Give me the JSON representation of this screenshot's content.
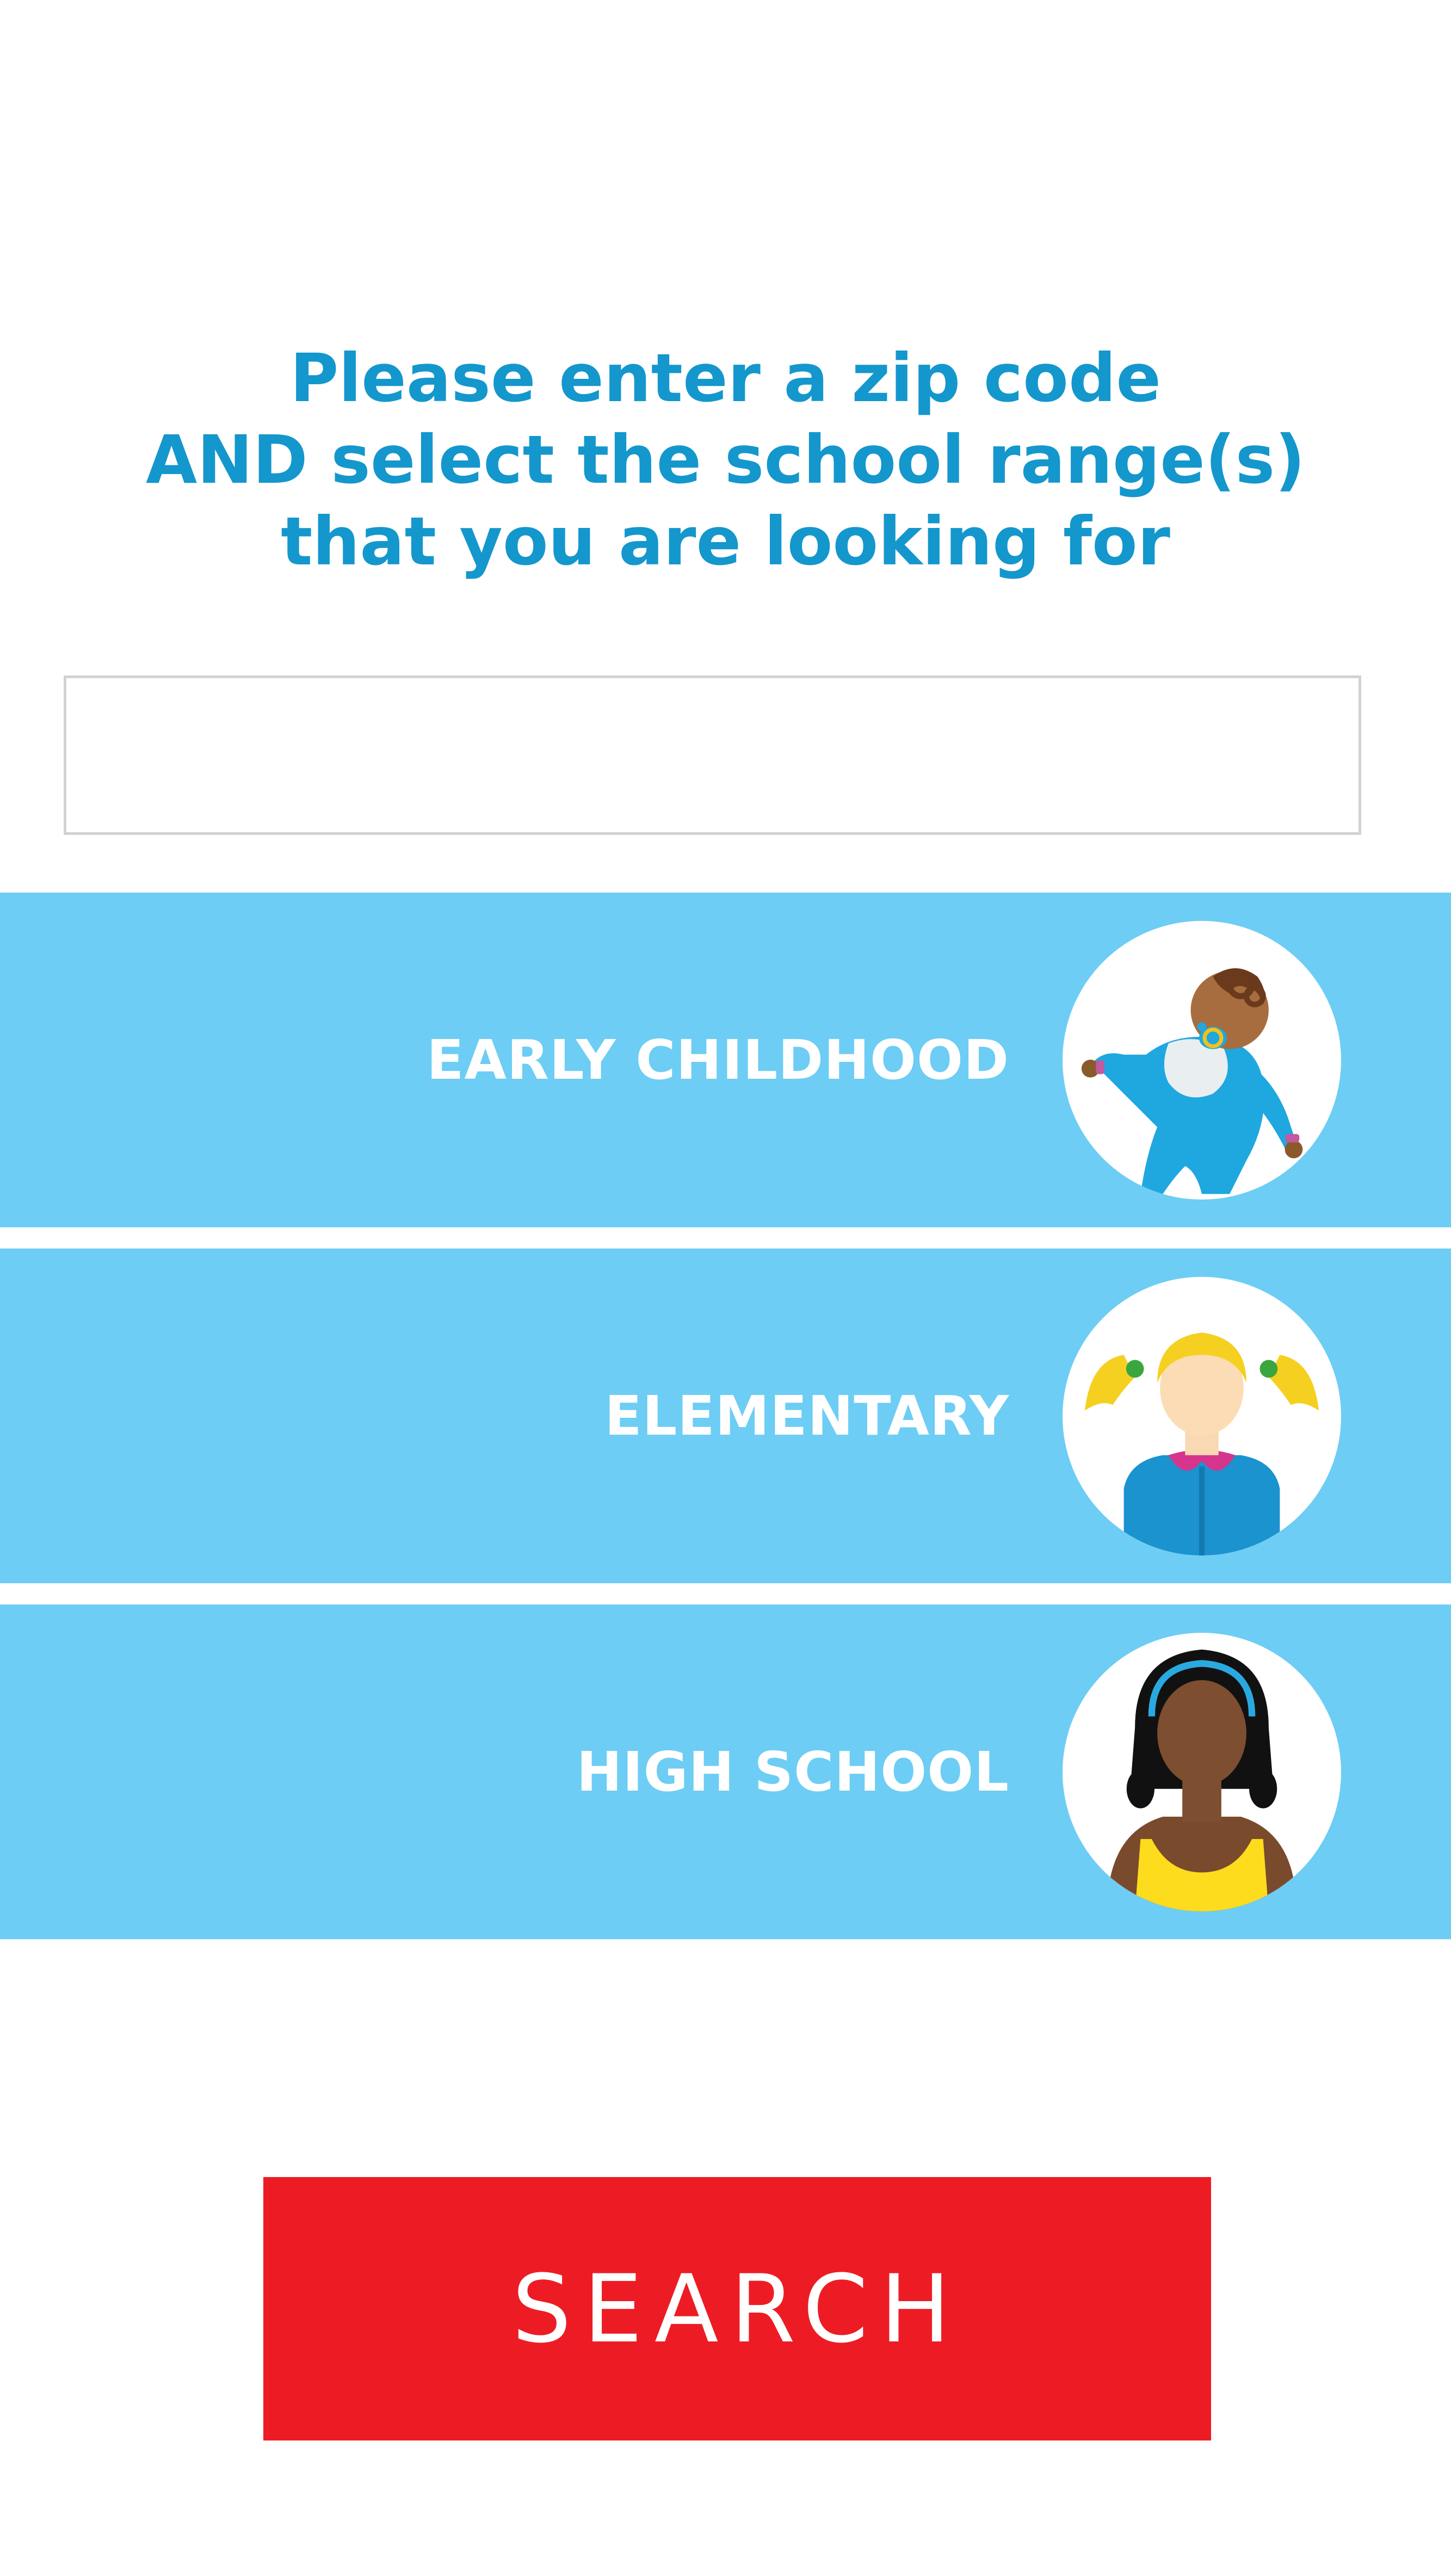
{
  "instructions": {
    "line1": "Please enter a zip code",
    "line2": "AND select the school range(s)",
    "line3": "that you are looking for"
  },
  "zip_input": {
    "value": "",
    "placeholder": ""
  },
  "ranges": [
    {
      "label": "EARLY CHILDHOOD",
      "icon": "baby-icon"
    },
    {
      "label": "ELEMENTARY",
      "icon": "girl-pigtails-icon"
    },
    {
      "label": "HIGH SCHOOL",
      "icon": "teen-girl-icon"
    }
  ],
  "search_button": {
    "label": "SEARCH"
  },
  "colors": {
    "heading": "#1497cc",
    "row_background": "#6dcdf4",
    "search_button": "#ed1c24"
  }
}
